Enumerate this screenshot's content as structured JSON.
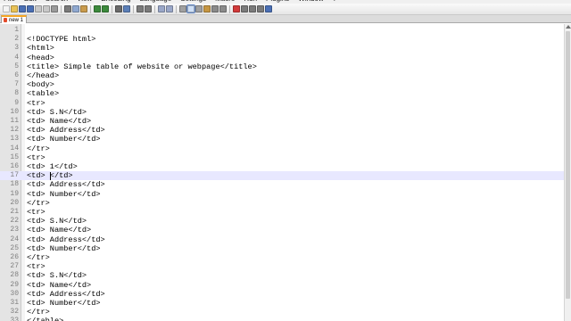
{
  "menubar": {
    "items": [
      "File",
      "Edit",
      "Search",
      "View",
      "Encoding",
      "Language",
      "Settings",
      "Macro",
      "Run",
      "Plugins",
      "Window",
      "?"
    ]
  },
  "toolbar": {
    "buttons": [
      {
        "name": "new-file-icon",
        "color": "#f4f4f4"
      },
      {
        "name": "open-file-icon",
        "color": "#e8c256"
      },
      {
        "name": "save-icon",
        "color": "#4a6fb5"
      },
      {
        "name": "save-all-icon",
        "color": "#4a6fb5"
      },
      {
        "name": "close-icon",
        "color": "#c8c8c8"
      },
      {
        "name": "close-all-icon",
        "color": "#c8c8c8"
      },
      {
        "name": "print-icon",
        "color": "#9a9a9a"
      },
      {
        "sep": true
      },
      {
        "name": "cut-icon",
        "color": "#7a7a7a"
      },
      {
        "name": "copy-icon",
        "color": "#8fa8d0"
      },
      {
        "name": "paste-icon",
        "color": "#c99b4c"
      },
      {
        "sep": true
      },
      {
        "name": "undo-icon",
        "color": "#3c8a3c"
      },
      {
        "name": "redo-icon",
        "color": "#3c8a3c"
      },
      {
        "sep": true
      },
      {
        "name": "find-icon",
        "color": "#6a6a6a"
      },
      {
        "name": "replace-icon",
        "color": "#5b7fb8"
      },
      {
        "sep": true
      },
      {
        "name": "zoom-in-icon",
        "color": "#7a7a7a"
      },
      {
        "name": "zoom-out-icon",
        "color": "#7a7a7a"
      },
      {
        "sep": true
      },
      {
        "name": "sync-v-icon",
        "color": "#9aa7c8"
      },
      {
        "name": "sync-h-icon",
        "color": "#9aa7c8"
      },
      {
        "sep": true
      },
      {
        "name": "word-wrap-icon",
        "color": "#a0a0a0"
      },
      {
        "name": "show-all-chars-icon",
        "color": "#5a7fbf",
        "selected": true
      },
      {
        "name": "indent-guide-icon",
        "color": "#a0a0a0"
      },
      {
        "name": "udl-icon",
        "color": "#c69642"
      },
      {
        "name": "doc-map-icon",
        "color": "#8a8a8a"
      },
      {
        "name": "func-list-icon",
        "color": "#8a8a8a"
      },
      {
        "sep": true
      },
      {
        "name": "record-macro-icon",
        "color": "#d23a3a"
      },
      {
        "name": "stop-macro-icon",
        "color": "#7a7a7a"
      },
      {
        "name": "play-macro-icon",
        "color": "#7a7a7a"
      },
      {
        "name": "run-macro-multiple-icon",
        "color": "#7a7a7a"
      },
      {
        "name": "save-macro-icon",
        "color": "#4a6fb5"
      }
    ]
  },
  "tabs": [
    {
      "label": "new 1",
      "active": true
    }
  ],
  "editor": {
    "current_line": 17,
    "lines": [
      {
        "n": "1",
        "text": ""
      },
      {
        "n": "2",
        "text": "<!DOCTYPE html>"
      },
      {
        "n": "3",
        "text": "<html>"
      },
      {
        "n": "4",
        "text": "<head>"
      },
      {
        "n": "5",
        "text": "<title> Simple table of website or webpage</title>"
      },
      {
        "n": "6",
        "text": "</head>"
      },
      {
        "n": "7",
        "text": "<body>"
      },
      {
        "n": "8",
        "text": "<table>"
      },
      {
        "n": "9",
        "text": "<tr>"
      },
      {
        "n": "10",
        "text": "<td> S.N</td>"
      },
      {
        "n": "11",
        "text": "<td> Name</td>"
      },
      {
        "n": "12",
        "text": "<td> Address</td>"
      },
      {
        "n": "13",
        "text": "<td> Number</td>"
      },
      {
        "n": "14",
        "text": "</tr>"
      },
      {
        "n": "15",
        "text": "<tr>"
      },
      {
        "n": "16",
        "text": "<td> 1</td>"
      },
      {
        "n": "17",
        "text": "<td> </td>"
      },
      {
        "n": "18",
        "text": "<td> Address</td>"
      },
      {
        "n": "19",
        "text": "<td> Number</td>"
      },
      {
        "n": "20",
        "text": "</tr>"
      },
      {
        "n": "21",
        "text": "<tr>"
      },
      {
        "n": "22",
        "text": "<td> S.N</td>"
      },
      {
        "n": "23",
        "text": "<td> Name</td>"
      },
      {
        "n": "24",
        "text": "<td> Address</td>"
      },
      {
        "n": "25",
        "text": "<td> Number</td>"
      },
      {
        "n": "26",
        "text": "</tr>"
      },
      {
        "n": "27",
        "text": "<tr>"
      },
      {
        "n": "28",
        "text": "<td> S.N</td>"
      },
      {
        "n": "29",
        "text": "<td> Name</td>"
      },
      {
        "n": "30",
        "text": "<td> Address</td>"
      },
      {
        "n": "31",
        "text": "<td> Number</td>"
      },
      {
        "n": "32",
        "text": "</tr>"
      },
      {
        "n": "33",
        "text": "</table>"
      }
    ]
  },
  "colors": {
    "current_line_bg": "#e8e8ff",
    "line_number": "#808080",
    "tab_accent": "#f5a623"
  }
}
